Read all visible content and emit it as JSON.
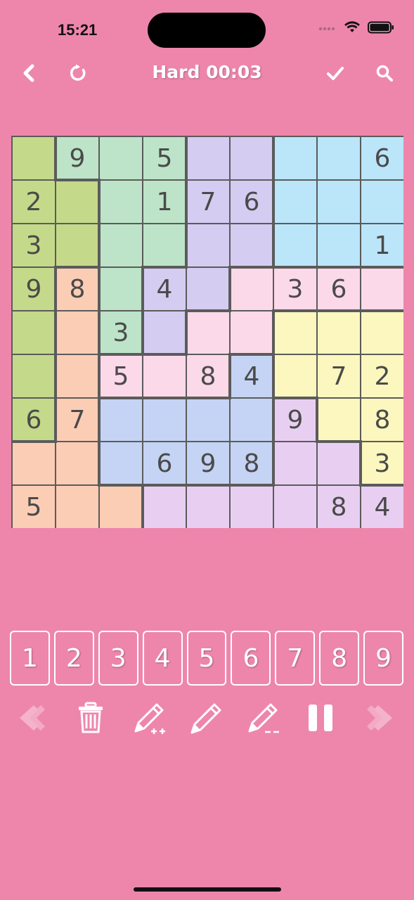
{
  "status": {
    "time": "15:21"
  },
  "toolbar": {
    "title": "Hard 00:03",
    "back_icon": "chevron-left-icon",
    "restart_icon": "restart-icon",
    "check_icon": "checkmark-icon",
    "search_icon": "search-icon"
  },
  "colors": {
    "background": "#ee86ab",
    "region_colors": [
      "#c5d98a",
      "#bde4c8",
      "#d5ccf2",
      "#bbe5f9",
      "#fcd9e8",
      "#fccdb5",
      "#fbf7be",
      "#c5d3f4",
      "#e8cff2"
    ]
  },
  "puzzle": {
    "difficulty": "Hard",
    "elapsed": "00:03",
    "regions": [
      [
        0,
        1,
        1,
        1,
        2,
        2,
        3,
        3,
        3
      ],
      [
        0,
        0,
        1,
        1,
        2,
        2,
        3,
        3,
        3
      ],
      [
        0,
        0,
        1,
        1,
        2,
        2,
        3,
        3,
        3
      ],
      [
        0,
        5,
        1,
        2,
        2,
        4,
        4,
        4,
        4
      ],
      [
        0,
        5,
        1,
        2,
        4,
        4,
        6,
        6,
        6
      ],
      [
        0,
        5,
        4,
        4,
        4,
        7,
        6,
        6,
        6
      ],
      [
        0,
        5,
        7,
        7,
        7,
        7,
        8,
        6,
        6
      ],
      [
        5,
        5,
        7,
        7,
        7,
        7,
        8,
        8,
        6
      ],
      [
        5,
        5,
        5,
        8,
        8,
        8,
        8,
        8,
        8
      ]
    ],
    "cells": [
      [
        "",
        "9",
        "",
        "5",
        "",
        "",
        "",
        "",
        "6"
      ],
      [
        "2",
        "",
        "",
        "1",
        "7",
        "6",
        "",
        "",
        ""
      ],
      [
        "3",
        "",
        "",
        "",
        "",
        "",
        "",
        "",
        "1"
      ],
      [
        "9",
        "8",
        "",
        "4",
        "",
        "",
        "3",
        "6",
        ""
      ],
      [
        "",
        "",
        "3",
        "",
        "",
        "",
        "",
        "",
        ""
      ],
      [
        "",
        "",
        "5",
        "",
        "8",
        "4",
        "",
        "7",
        "2"
      ],
      [
        "6",
        "7",
        "",
        "",
        "",
        "",
        "9",
        "",
        "8"
      ],
      [
        "",
        "",
        "",
        "6",
        "9",
        "8",
        "",
        "",
        "3"
      ],
      [
        "5",
        "",
        "",
        "",
        "",
        "",
        "",
        "8",
        "4"
      ]
    ]
  },
  "numpad": {
    "keys": [
      "1",
      "2",
      "3",
      "4",
      "5",
      "6",
      "7",
      "8",
      "9"
    ]
  },
  "tools": [
    {
      "name": "undo-button",
      "icon": "arrow-left-icon"
    },
    {
      "name": "erase-button",
      "icon": "trash-icon"
    },
    {
      "name": "auto-notes-button",
      "icon": "pencil-plus-icon"
    },
    {
      "name": "pencil-button",
      "icon": "pencil-icon"
    },
    {
      "name": "clear-notes-button",
      "icon": "pencil-minus-icon"
    },
    {
      "name": "pause-button",
      "icon": "pause-icon"
    },
    {
      "name": "redo-button",
      "icon": "arrow-right-icon"
    }
  ]
}
